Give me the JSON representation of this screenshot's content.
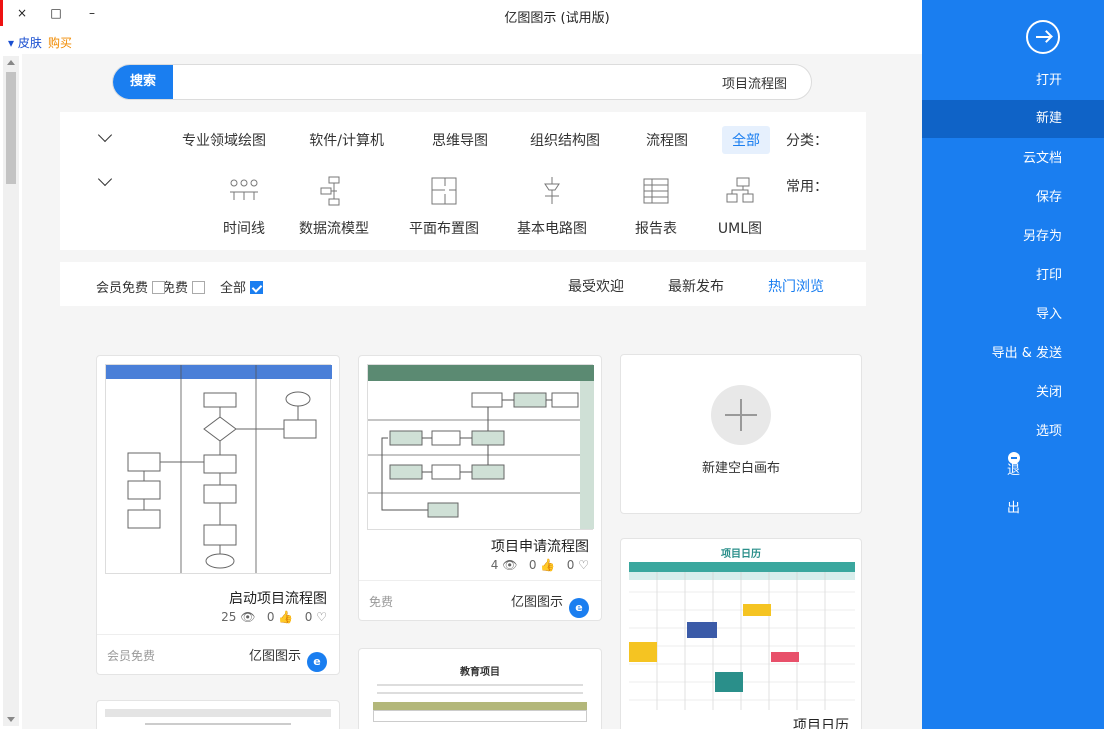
{
  "window": {
    "title": "亿图图示 (试用版)",
    "close": "×",
    "maximize": "□",
    "minimize": "–"
  },
  "topbar": {
    "buy": "购买",
    "skin": "皮肤"
  },
  "search": {
    "button": "搜索",
    "value": "项目流程图"
  },
  "filters": {
    "category_label": "分类：",
    "categories": [
      "全部",
      "流程图",
      "组织结构图",
      "思维导图",
      "软件/计算机",
      "专业领域绘图"
    ],
    "common_label": "常用：",
    "common": [
      "UML图",
      "报告表",
      "基本电路图",
      "平面布置图",
      "数据流模型",
      "时间线"
    ]
  },
  "sort": {
    "tabs": [
      "热门浏览",
      "最新发布",
      "最受欢迎"
    ],
    "checks": [
      "全部",
      "免费",
      "会员免费"
    ]
  },
  "new_canvas": {
    "label": "新建空白画布"
  },
  "cards": [
    {
      "title": "启动项目流程图",
      "views": "25",
      "likes": "0",
      "favs": "0",
      "brand": "亿图图示",
      "price": "会员免费"
    },
    {
      "title": "项目申请流程图",
      "views": "4",
      "likes": "0",
      "favs": "0",
      "brand": "亿图图示",
      "price": "免费"
    },
    {
      "title": "项目日历",
      "header": "项目日历"
    },
    {
      "title": "教育项目"
    }
  ],
  "sidebar": {
    "items": [
      "打开",
      "新建",
      "云文档",
      "保存",
      "另存为",
      "打印",
      "导入",
      "导出 & 发送",
      "关闭",
      "选项",
      "退出"
    ]
  },
  "colors": {
    "accent": "#1a7ef0",
    "sidebar_active": "#0f63c7"
  }
}
